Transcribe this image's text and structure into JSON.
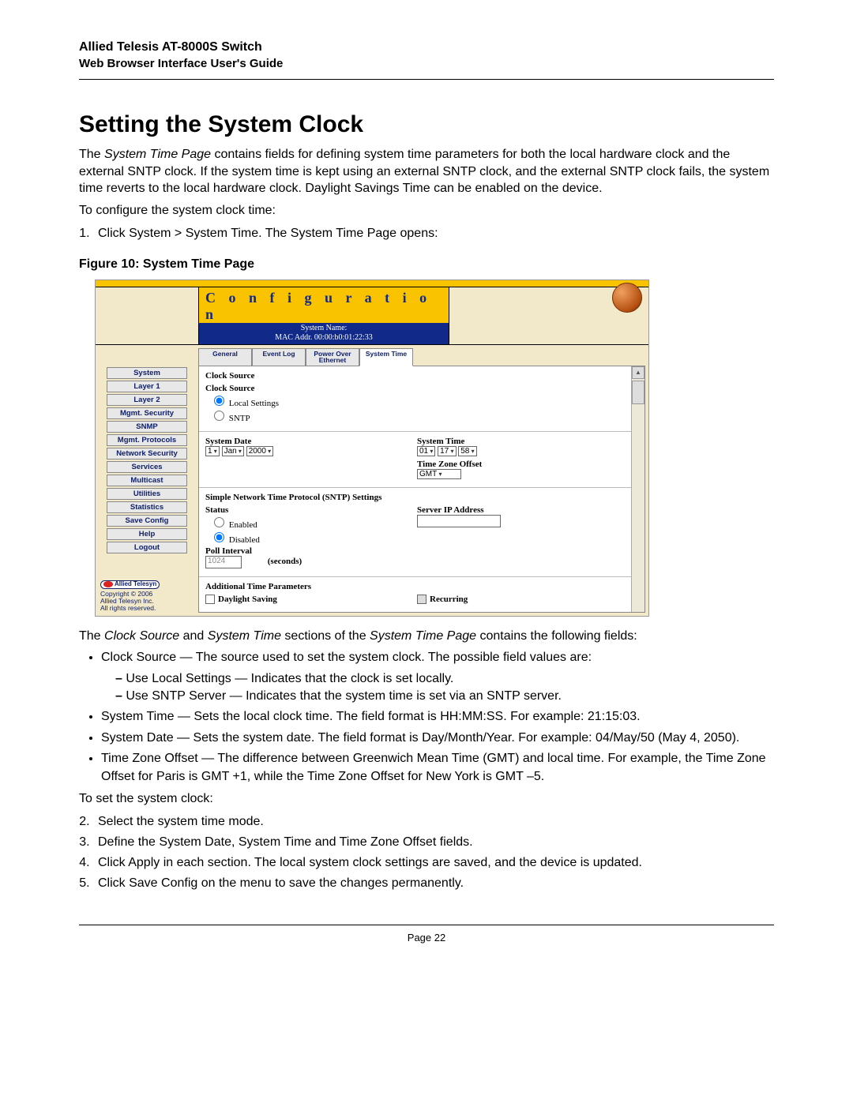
{
  "header": {
    "title": "Allied Telesis AT-8000S Switch",
    "subtitle": "Web Browser Interface User's Guide"
  },
  "section": {
    "heading": "Setting the System Clock",
    "intro_prefix": "The ",
    "intro_italic": "System Time Page",
    "intro_rest": " contains fields for defining system time parameters for both the local hardware clock and the external SNTP clock. If the system time is kept using an external SNTP clock, and the external SNTP clock fails, the system time reverts to the local hardware clock. Daylight Savings Time can be enabled on the device.",
    "configure_lead": "To configure the system clock time:",
    "step1_prefix": "Click ",
    "step1_bold": "System > System Time",
    "step1_mid": ". The ",
    "step1_italic": "System Time Page",
    "step1_end": " opens:",
    "figure_caption": "Figure 10:  System Time Page",
    "post_fig_prefix": "The ",
    "post_fig_i1": "Clock Source",
    "post_fig_mid1": " and ",
    "post_fig_i2": "System Time",
    "post_fig_mid2": " sections of the ",
    "post_fig_i3": "System Time Page",
    "post_fig_end": " contains the following fields:"
  },
  "fields": {
    "clock_source_title": "Clock Source",
    "clock_source_desc": " — The source used to set the system clock. The possible field values are:",
    "local_title": "Use Local Settings",
    "local_desc": " — Indicates that the clock is set locally.",
    "sntp_title": "Use SNTP Server",
    "sntp_desc": " — Indicates that the system time is set via an SNTP server.",
    "systime_title": "System Time",
    "systime_desc": " — Sets the local clock time. The field format is HH:MM:SS. For example: 21:15:03.",
    "sysdate_title": "System Date",
    "sysdate_desc": " — Sets the system date. The field format is Day/Month/Year. For example: 04/May/50 (May 4, 2050).",
    "tzo_title": "Time Zone Offset",
    "tzo_desc": " — The difference between Greenwich Mean Time (GMT) and local time. For example, the Time Zone Offset for Paris is GMT +1, while the Time Zone Offset for New York is GMT –5."
  },
  "set_steps": {
    "lead": "To set the system clock:",
    "s2": "Select the system time mode.",
    "s3_prefix": "Define the ",
    "s3_italic": "System Date, System Time and Time Zone Offset",
    "s3_end": " fields.",
    "s4_prefix": "Click ",
    "s4_bold": "Apply",
    "s4_end": " in each section. The local system clock settings are saved, and the device is updated.",
    "s5_prefix": " Click ",
    "s5_bold": "Save Config",
    "s5_end": " on the menu to save the changes permanently."
  },
  "footer": {
    "page": "Page 22"
  },
  "shot": {
    "config_title": "C o n f i g u r a t i o n",
    "sysname_lbl": "System Name:",
    "mac_lbl": "MAC Addr.   00:00:b0:01:22:33",
    "sidebar": [
      "System",
      "Layer 1",
      "Layer 2",
      "Mgmt. Security",
      "SNMP",
      "Mgmt. Protocols",
      "Network Security",
      "Services",
      "Multicast",
      "Utilities",
      "Statistics",
      "Save Config",
      "Help",
      "Logout"
    ],
    "at_brand": "Allied Telesyn",
    "copyright": "Copyright © 2006",
    "company": "Allied Telesyn Inc.",
    "rights": "All rights reserved.",
    "tabs": {
      "t1": "General",
      "t2": "Event Log",
      "t3a": "Power Over",
      "t3b": "Ethernet",
      "t4": "System Time"
    },
    "sect1_title": "Clock Source",
    "sect1_sub": "Clock Source",
    "radio_local": "Local Settings",
    "radio_sntp": "SNTP",
    "sect2_date_lbl": "System Date",
    "date_day": "1",
    "date_mon": "Jan",
    "date_year": "2000",
    "sect2_time_lbl": "System Time",
    "time_h": "01",
    "time_m": "17",
    "time_s": "58",
    "tzo_lbl": "Time Zone Offset",
    "tzo_val": "GMT",
    "sect3_title": "Simple Network Time Protocol (SNTP) Settings",
    "status_lbl": "Status",
    "status_en": "Enabled",
    "status_dis": "Disabled",
    "poll_lbl": "Poll Interval",
    "poll_val": "1024",
    "poll_unit": "(seconds)",
    "server_lbl": "Server IP Address",
    "sect4_title": "Additional Time Parameters",
    "daylight": "Daylight Saving",
    "recurring": "Recurring"
  }
}
